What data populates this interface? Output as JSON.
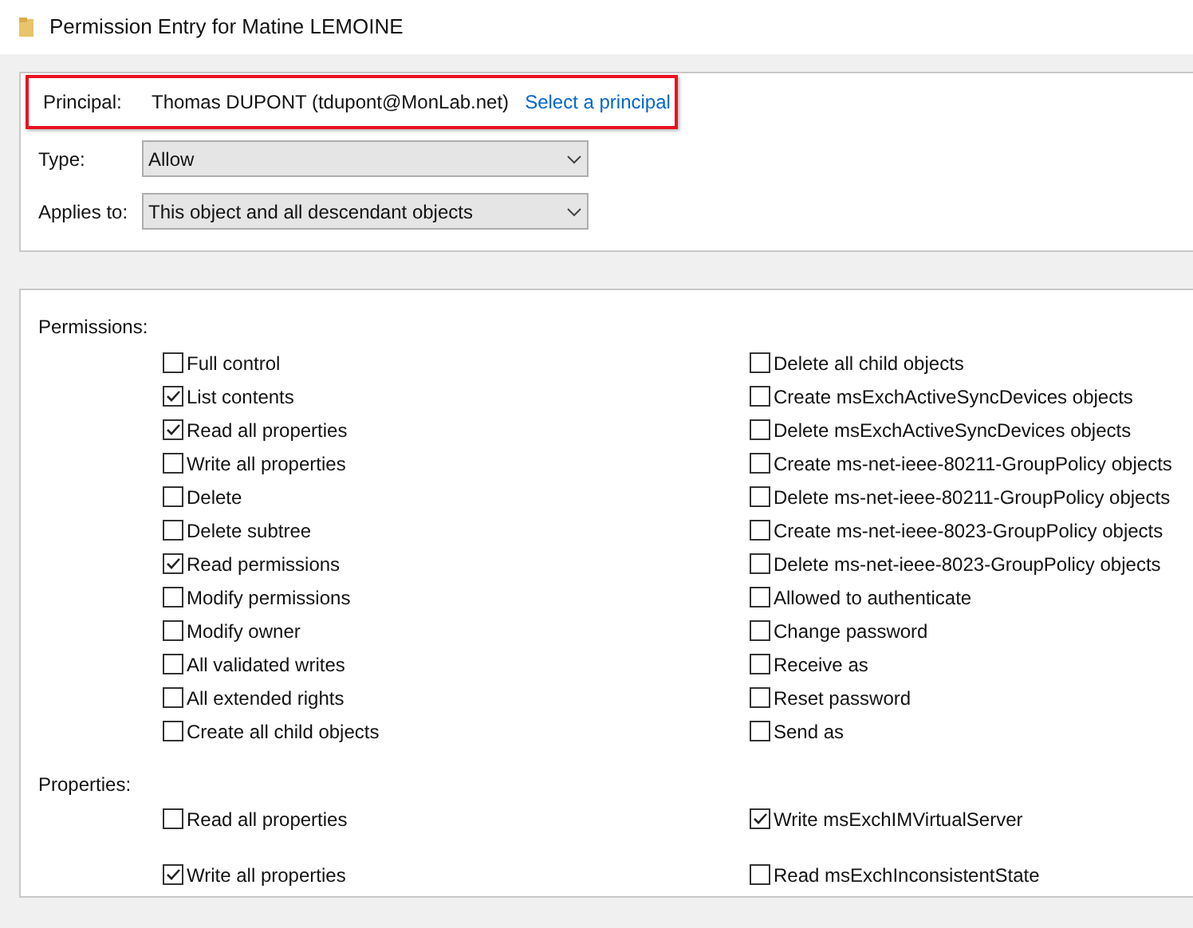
{
  "window": {
    "title": "Permission Entry for Matine LEMOINE"
  },
  "principal": {
    "label": "Principal:",
    "value": "Thomas DUPONT (tdupont@MonLab.net)",
    "link": "Select a principal",
    "highlighted": true
  },
  "fields": [
    {
      "label": "Type:",
      "value": "Allow"
    },
    {
      "label": "Applies to:",
      "value": "This object and all descendant objects"
    }
  ],
  "permissions": {
    "label": "Permissions:",
    "left": [
      {
        "label": "Full control",
        "checked": false
      },
      {
        "label": "List contents",
        "checked": true
      },
      {
        "label": "Read all properties",
        "checked": true
      },
      {
        "label": "Write all properties",
        "checked": false
      },
      {
        "label": "Delete",
        "checked": false
      },
      {
        "label": "Delete subtree",
        "checked": false
      },
      {
        "label": "Read permissions",
        "checked": true
      },
      {
        "label": "Modify permissions",
        "checked": false
      },
      {
        "label": "Modify owner",
        "checked": false
      },
      {
        "label": "All validated writes",
        "checked": false
      },
      {
        "label": "All extended rights",
        "checked": false
      },
      {
        "label": "Create all child objects",
        "checked": false
      }
    ],
    "right": [
      {
        "label": "Delete all child objects",
        "checked": false
      },
      {
        "label": "Create msExchActiveSyncDevices objects",
        "checked": false
      },
      {
        "label": "Delete msExchActiveSyncDevices objects",
        "checked": false
      },
      {
        "label": "Create ms-net-ieee-80211-GroupPolicy objects",
        "checked": false
      },
      {
        "label": "Delete ms-net-ieee-80211-GroupPolicy objects",
        "checked": false
      },
      {
        "label": "Create ms-net-ieee-8023-GroupPolicy objects",
        "checked": false
      },
      {
        "label": "Delete ms-net-ieee-8023-GroupPolicy objects",
        "checked": false
      },
      {
        "label": "Allowed to authenticate",
        "checked": false
      },
      {
        "label": "Change password",
        "checked": false
      },
      {
        "label": "Receive as",
        "checked": false
      },
      {
        "label": "Reset password",
        "checked": false
      },
      {
        "label": "Send as",
        "checked": false
      }
    ]
  },
  "properties": {
    "label": "Properties:",
    "left": [
      {
        "label": "Read all properties",
        "checked": false
      },
      {
        "label": "Write all properties",
        "checked": true
      }
    ],
    "right": [
      {
        "label": "Write msExchIMVirtualServer",
        "checked": true
      },
      {
        "label": "Read msExchInconsistentState",
        "checked": false
      }
    ]
  }
}
